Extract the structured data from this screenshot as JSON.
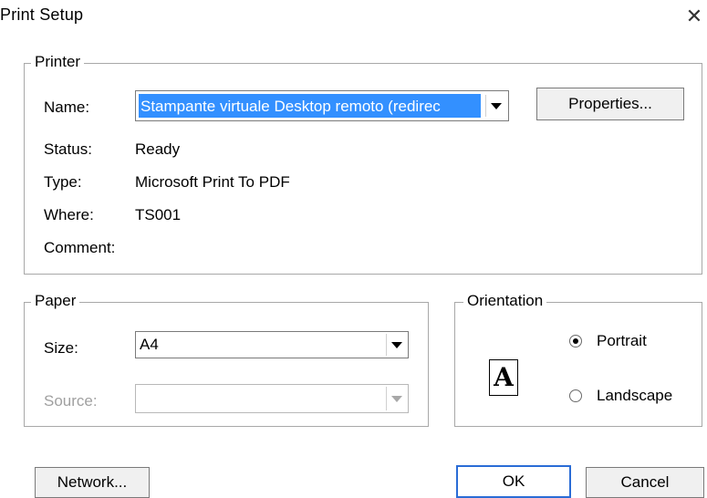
{
  "window": {
    "title": "Print Setup",
    "close_glyph": "✕"
  },
  "printer": {
    "legend": "Printer",
    "name_label": "Name:",
    "name_value": "Stampante virtuale Desktop remoto (redirec",
    "properties_button": "Properties...",
    "status_label": "Status:",
    "status_value": "Ready",
    "type_label": "Type:",
    "type_value": "Microsoft Print To PDF",
    "where_label": "Where:",
    "where_value": "TS001",
    "comment_label": "Comment:",
    "comment_value": ""
  },
  "paper": {
    "legend": "Paper",
    "size_label": "Size:",
    "size_value": "A4",
    "source_label": "Source:",
    "source_value": ""
  },
  "orientation": {
    "legend": "Orientation",
    "portrait_label": "Portrait",
    "landscape_label": "Landscape",
    "selected": "portrait",
    "preview_glyph": "A"
  },
  "footer": {
    "network_button": "Network...",
    "ok_button": "OK",
    "cancel_button": "Cancel"
  }
}
